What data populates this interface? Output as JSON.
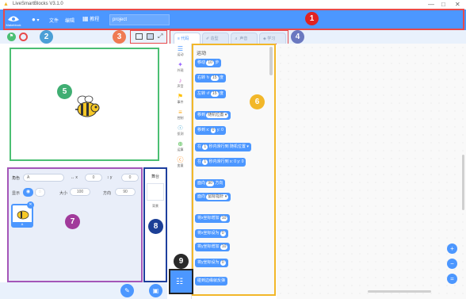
{
  "window": {
    "title": "LiveSmartBlocks V3.1.0",
    "controls": [
      "—",
      "□",
      "✕"
    ]
  },
  "menubar": {
    "logo_label": "Makeblock",
    "lang_label": "▾",
    "menu_file": "文件",
    "menu_edit": "编辑",
    "menu_tutorial": "教程",
    "project_name": "project"
  },
  "badges": [
    "1",
    "2",
    "3",
    "4",
    "5",
    "6",
    "7",
    "8",
    "9"
  ],
  "tabs": [
    {
      "label": "代码"
    },
    {
      "label": "造型"
    },
    {
      "label": "声音"
    },
    {
      "label": "学习"
    }
  ],
  "categories": [
    {
      "icon": "☰",
      "label": "运动"
    },
    {
      "icon": "✦",
      "label": "外观"
    },
    {
      "icon": "♪",
      "label": "声音"
    },
    {
      "icon": "⚑",
      "label": "事件"
    },
    {
      "icon": "≡",
      "label": "控制"
    },
    {
      "icon": "☉",
      "label": "侦测"
    },
    {
      "icon": "⊕",
      "label": "运算"
    },
    {
      "icon": "ⓒ",
      "label": "变量"
    }
  ],
  "palette": {
    "heading": "运动",
    "blocks": [
      {
        "text": "移动",
        "slot": "10",
        "suffix": "步"
      },
      {
        "text": "右转 ↻",
        "slot": "15",
        "suffix": "度"
      },
      {
        "text": "左转 ↺",
        "slot": "15",
        "suffix": "度"
      },
      {
        "text": "移到",
        "slot": "随机位置 ▾",
        "suffix": ""
      },
      {
        "text": "移到 x:",
        "slot": "0",
        "suffix": "y: 0"
      },
      {
        "text": "在",
        "slot": "1",
        "suffix": "秒内滑行到 随机位置 ▾"
      },
      {
        "text": "在",
        "slot": "1",
        "suffix": "秒内滑行到 x: 0 y: 0"
      },
      {
        "text": "面向",
        "slot": "90",
        "suffix": "方向"
      },
      {
        "text": "面向",
        "slot": "鼠标指针 ▾",
        "suffix": ""
      },
      {
        "text": "将x坐标增加",
        "slot": "10",
        "suffix": ""
      },
      {
        "text": "将x坐标设为",
        "slot": "0",
        "suffix": ""
      },
      {
        "text": "将y坐标增加",
        "slot": "10",
        "suffix": ""
      },
      {
        "text": "将y坐标设为",
        "slot": "0",
        "suffix": ""
      },
      {
        "text": "碰到边缘就反弹",
        "slot": "",
        "suffix": ""
      }
    ]
  },
  "sprite_props": {
    "name_label": "角色",
    "name_value": "A",
    "x_label": "↔ x",
    "x_value": "0",
    "y_label": "↕ y",
    "y_value": "0",
    "show_label": "显示",
    "size_label": "大小",
    "size_value": "100",
    "dir_label": "方向",
    "dir_value": "90"
  },
  "sprite_thumb_label": "A",
  "backdrop": {
    "title": "舞台",
    "label": "背景"
  },
  "zoom": [
    "+",
    "−",
    "="
  ],
  "colors": {
    "menubar": "#4c97ff",
    "stage_border": "#4bbf73",
    "sprite_border": "#a456b8",
    "palette_border": "#f2b729",
    "backdrop_border": "#1e3f9e",
    "highlight": "#e84a4a"
  }
}
